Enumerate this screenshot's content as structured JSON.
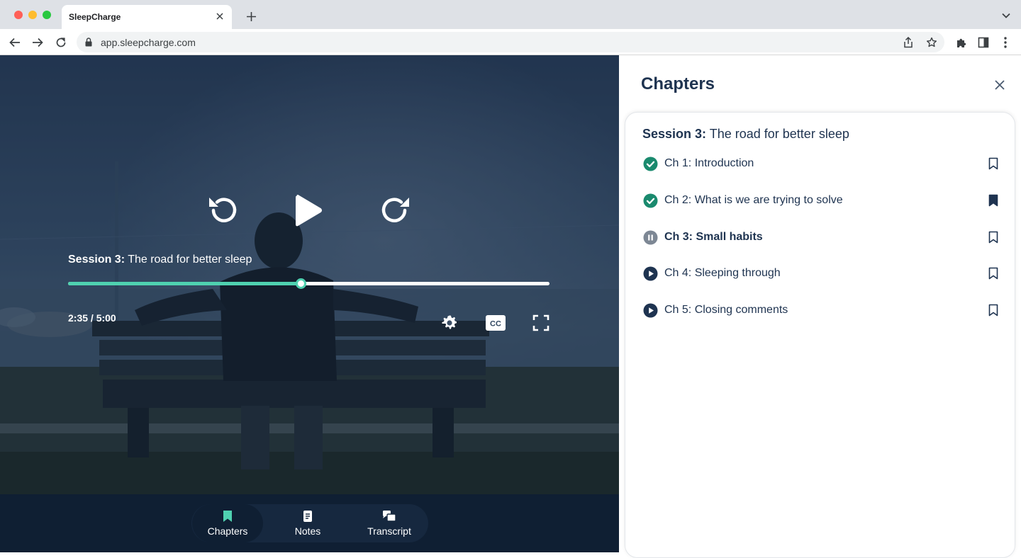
{
  "browser": {
    "tab_title": "SleepCharge",
    "url": "app.sleepcharge.com"
  },
  "player": {
    "session_prefix": "Session 3:",
    "session_title": "The road for better sleep",
    "time": "2:35 / 5:00",
    "progress": 0.483,
    "accent": "#4fd1b0"
  },
  "bottom_tabs": [
    {
      "label": "Chapters",
      "icon": "bookmark-icon",
      "active": true
    },
    {
      "label": "Notes",
      "icon": "notes-icon",
      "active": false
    },
    {
      "label": "Transcript",
      "icon": "transcript-icon",
      "active": false
    }
  ],
  "panel": {
    "title": "Chapters",
    "session_prefix": "Session 3:",
    "session_title": "The road for better sleep",
    "chapters": [
      {
        "label": "Ch 1: Introduction",
        "status": "completed",
        "bookmarked": false
      },
      {
        "label": "Ch 2: What is we are trying to solve",
        "status": "completed",
        "bookmarked": true
      },
      {
        "label": "Ch 3: Small habits",
        "status": "playing",
        "bookmarked": false
      },
      {
        "label": "Ch 4: Sleeping through",
        "status": "unplayed",
        "bookmarked": false
      },
      {
        "label": "Ch 5: Closing comments",
        "status": "unplayed",
        "bookmarked": false
      }
    ],
    "colors": {
      "completed": "#1a8a6e",
      "playing": "#7d8794",
      "unplayed": "#1e3350"
    }
  }
}
